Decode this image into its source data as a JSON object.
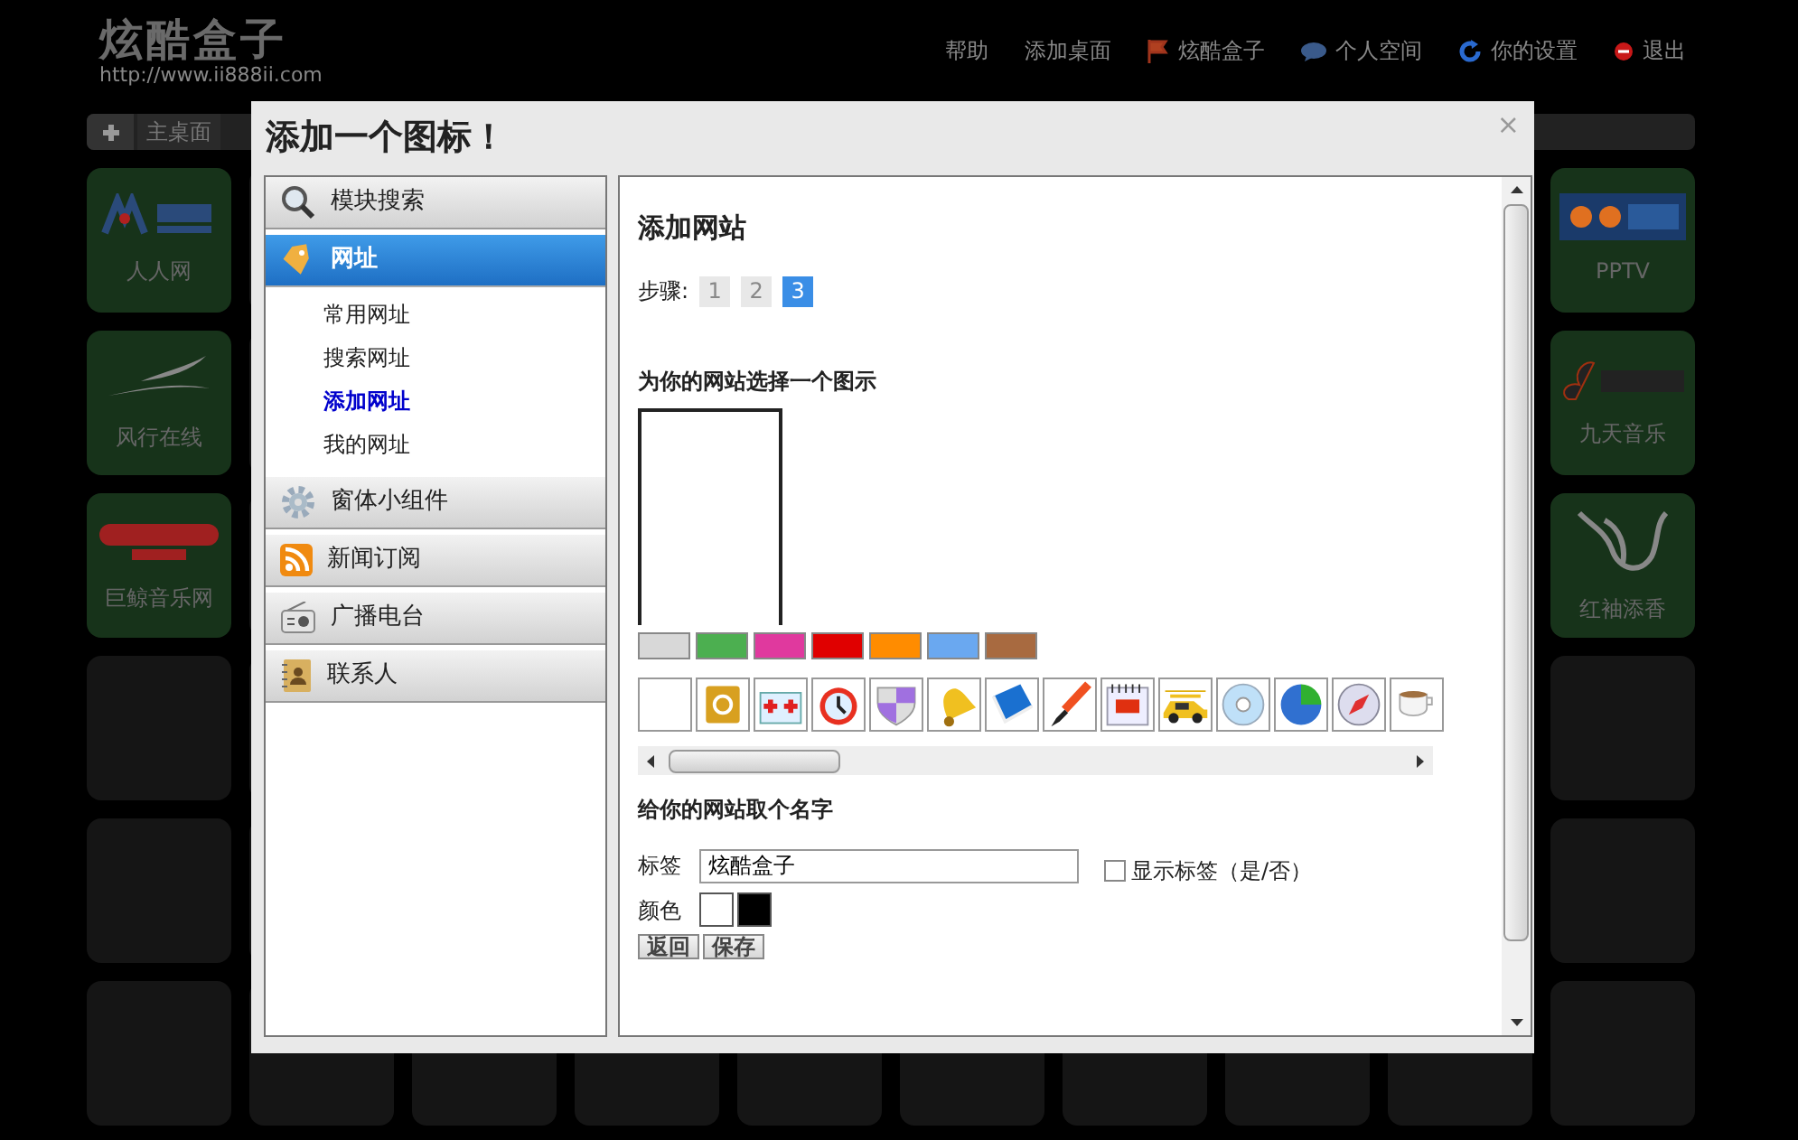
{
  "header": {
    "logo": "炫酷盒子",
    "url": "http://www.ii888ii.com",
    "nav": [
      {
        "label": "帮助"
      },
      {
        "label": "添加桌面"
      },
      {
        "label": "炫酷盒子"
      },
      {
        "label": "个人空间"
      },
      {
        "label": "你的设置"
      },
      {
        "label": "退出"
      }
    ]
  },
  "desktop_tabs": [
    {
      "label": "主桌面"
    }
  ],
  "tiles_left": [
    {
      "label": "人人网"
    },
    {
      "label": "风行在线"
    },
    {
      "label": "巨鲸音乐网"
    }
  ],
  "tiles_right": [
    {
      "label": "PPTV"
    },
    {
      "label": "九天音乐"
    },
    {
      "label": "红袖添香"
    }
  ],
  "dialog": {
    "title": "添加一个图标！",
    "close": "×",
    "sections": [
      {
        "label": "模块搜索",
        "selected": false
      },
      {
        "label": "网址",
        "selected": true,
        "children": [
          {
            "label": "常用网址",
            "selected": false
          },
          {
            "label": "搜索网址",
            "selected": false
          },
          {
            "label": "添加网址",
            "selected": true
          },
          {
            "label": "我的网址",
            "selected": false
          }
        ]
      },
      {
        "label": "窗体小组件",
        "selected": false
      },
      {
        "label": "新闻订阅",
        "selected": false
      },
      {
        "label": "广播电台",
        "selected": false
      },
      {
        "label": "联系人",
        "selected": false
      }
    ],
    "content": {
      "heading": "添加网站",
      "steps_label": "步骤:",
      "steps": [
        {
          "label": "1",
          "selected": false
        },
        {
          "label": "2",
          "selected": false
        },
        {
          "label": "3",
          "selected": true
        }
      ],
      "icon_section_title": "为你的网站选择一个图示",
      "swatches": [
        {
          "color": "#d8d8d8"
        },
        {
          "color": "#4caf50"
        },
        {
          "color": "#e0399e"
        },
        {
          "color": "#e00000"
        },
        {
          "color": "#ff8c00"
        },
        {
          "color": "#6aa8f0"
        },
        {
          "color": "#a86a40"
        }
      ],
      "name_section_title": "给你的网站取个名字",
      "tag_label": "标签",
      "tag_value": "炫酷盒子",
      "show_label": {
        "label": "显示标签（是/否）",
        "checked": false
      },
      "color_label": "颜色",
      "text_colors": [
        {
          "color": "#ffffff"
        },
        {
          "color": "#000000"
        }
      ],
      "buttons": [
        {
          "label": "返回"
        },
        {
          "label": "保存"
        }
      ]
    }
  }
}
